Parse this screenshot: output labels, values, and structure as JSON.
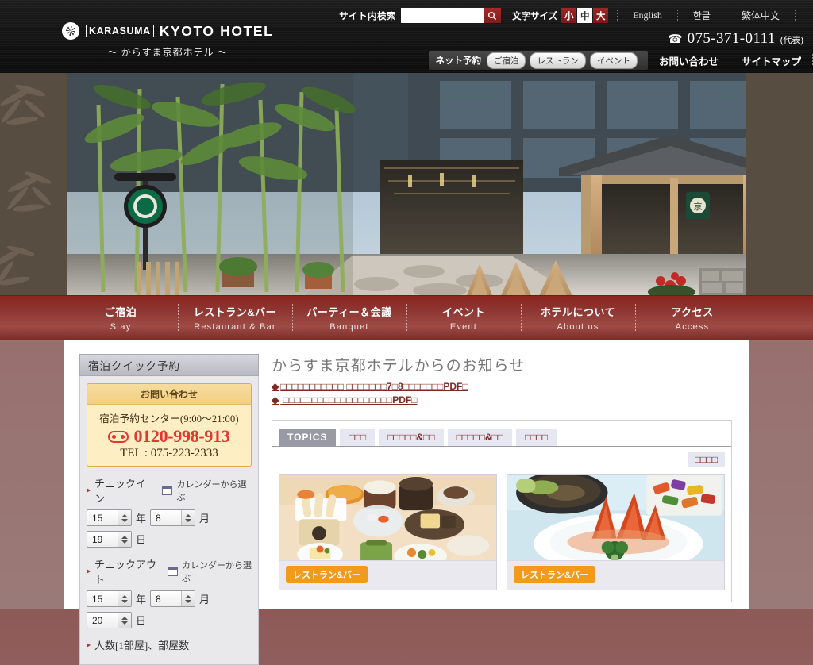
{
  "header": {
    "search": {
      "label": "サイト内検索",
      "value": "",
      "placeholder": "",
      "icon": "search-icon"
    },
    "fontsize": {
      "label": "文字サイズ",
      "options": [
        {
          "label": "小",
          "active": false
        },
        {
          "label": "中",
          "active": true
        },
        {
          "label": "大",
          "active": false
        }
      ]
    },
    "languages": [
      {
        "label": "English"
      },
      {
        "label": "한글"
      },
      {
        "label": "繁体中文"
      }
    ],
    "logo": {
      "badge": "KARASUMA",
      "name": "KYOTO HOTEL",
      "sub": "～ からすま京都ホテル ～",
      "mark_icon": "shutter-logo-icon"
    },
    "tel": {
      "icon": "telephone-icon",
      "number": "075-371-0111",
      "suffix": "(代表)"
    },
    "booking": {
      "title": "ネット予約",
      "pills": [
        {
          "label": "ご宿泊"
        },
        {
          "label": "レストラン"
        },
        {
          "label": "イベント"
        }
      ]
    },
    "links": [
      {
        "label": "お問い合わせ"
      },
      {
        "label": "サイトマップ"
      }
    ]
  },
  "mainnav": [
    {
      "ja": "ご宿泊",
      "en": "Stay"
    },
    {
      "ja": "レストラン&バー",
      "en": "Restaurant & Bar"
    },
    {
      "ja": "パーティー＆会議",
      "en": "Banquet"
    },
    {
      "ja": "イベント",
      "en": "Event"
    },
    {
      "ja": "ホテルについて",
      "en": "About us"
    },
    {
      "ja": "アクセス",
      "en": "Access"
    }
  ],
  "sidebar": {
    "quick_title": "宿泊クイック予約",
    "inquiry": {
      "title": "お問い合わせ",
      "center": "宿泊予約センター(9:00～21:00)",
      "freedial_icon": "freedial-icon",
      "freedial_number": "0120-998-913",
      "tel": "TEL : 075-223-2333"
    },
    "checkin": {
      "label": "チェックイン",
      "calendar_icon": "calendar-icon",
      "calendar_text": "カレンダーから選ぶ",
      "year": "15",
      "year_unit": "年",
      "month": "8",
      "month_unit": "月",
      "day": "19",
      "day_unit": "日"
    },
    "checkout": {
      "label": "チェックアウト",
      "calendar_icon": "calendar-icon",
      "calendar_text": "カレンダーから選ぶ",
      "year": "15",
      "year_unit": "年",
      "month": "8",
      "month_unit": "月",
      "day": "20",
      "day_unit": "日"
    },
    "guests_label": "人数[1部屋]、部屋数"
  },
  "content": {
    "title": "からすま京都ホテルからのお知らせ",
    "notices": [
      {
        "marker": "◆",
        "text": "□□□□□□□□□□□ □□□□□□□7□8□□□□□□□PDF□"
      },
      {
        "marker": "◆",
        "text": " □□□□□□□□□□□□□□□□□□□PDF□"
      }
    ],
    "tabs": [
      {
        "label": "TOPICS",
        "active": true
      },
      {
        "label": "□□□",
        "active": false
      },
      {
        "label": "□□□□□&□□",
        "active": false
      },
      {
        "label": "□□□□□&□□",
        "active": false
      },
      {
        "label": "□□□□",
        "active": false
      }
    ],
    "badge": "□□□□",
    "cards": [
      {
        "photo": "kaiseki-meal-photo",
        "tag": "レストラン&バー"
      },
      {
        "photo": "lobster-dish-photo",
        "tag": "レストラン&バー"
      }
    ]
  },
  "colors": {
    "brand_red": "#8b2420",
    "accent_orange": "#f29a1d",
    "link_red": "#7b2a26",
    "page_bg": "#97706e",
    "tab_inactive": "#e7e7f2",
    "tab_active": "#9a9aa6",
    "freedial_red": "#e0392f"
  }
}
